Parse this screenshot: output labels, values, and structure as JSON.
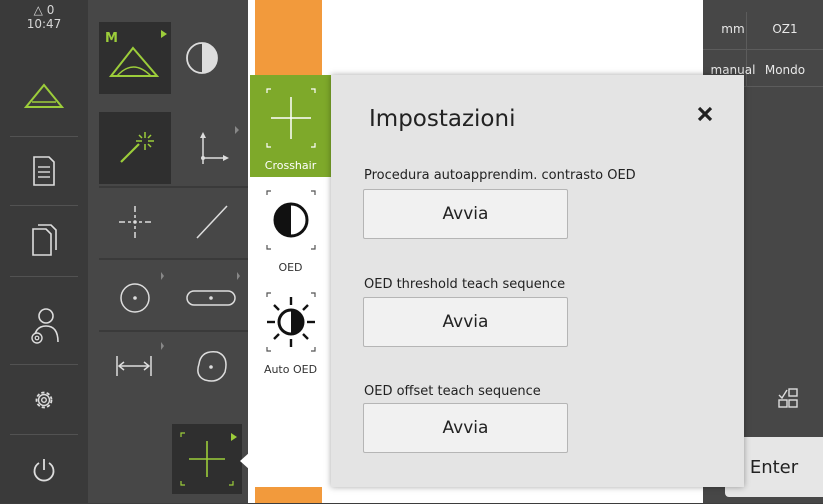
{
  "status": {
    "warnings": "0",
    "time": "10:47"
  },
  "sidebar": {
    "items": [
      {
        "name": "measure"
      },
      {
        "name": "protocol"
      },
      {
        "name": "files"
      },
      {
        "name": "user-settings"
      },
      {
        "name": "settings"
      },
      {
        "name": "power"
      }
    ]
  },
  "right_panel": {
    "unit": "mm",
    "zoom": "OZ1",
    "mode": "manual",
    "coord_system": "Mondo",
    "enter_label": "Enter"
  },
  "tabs": [
    {
      "label": "Crosshair",
      "selected": true
    },
    {
      "label": "OED",
      "selected": false
    },
    {
      "label": "Auto OED",
      "selected": false
    }
  ],
  "dialog": {
    "title": "Impostazioni",
    "sections": [
      {
        "label": "Procedura autoapprendim. contrasto OED",
        "button": "Avvia"
      },
      {
        "label": "OED threshold teach sequence",
        "button": "Avvia"
      },
      {
        "label": "OED offset teach sequence",
        "button": "Avvia"
      }
    ]
  },
  "colors": {
    "accent": "#7ea92a",
    "orange": "#f29a3c",
    "sidebar": "#3a3a3a"
  }
}
